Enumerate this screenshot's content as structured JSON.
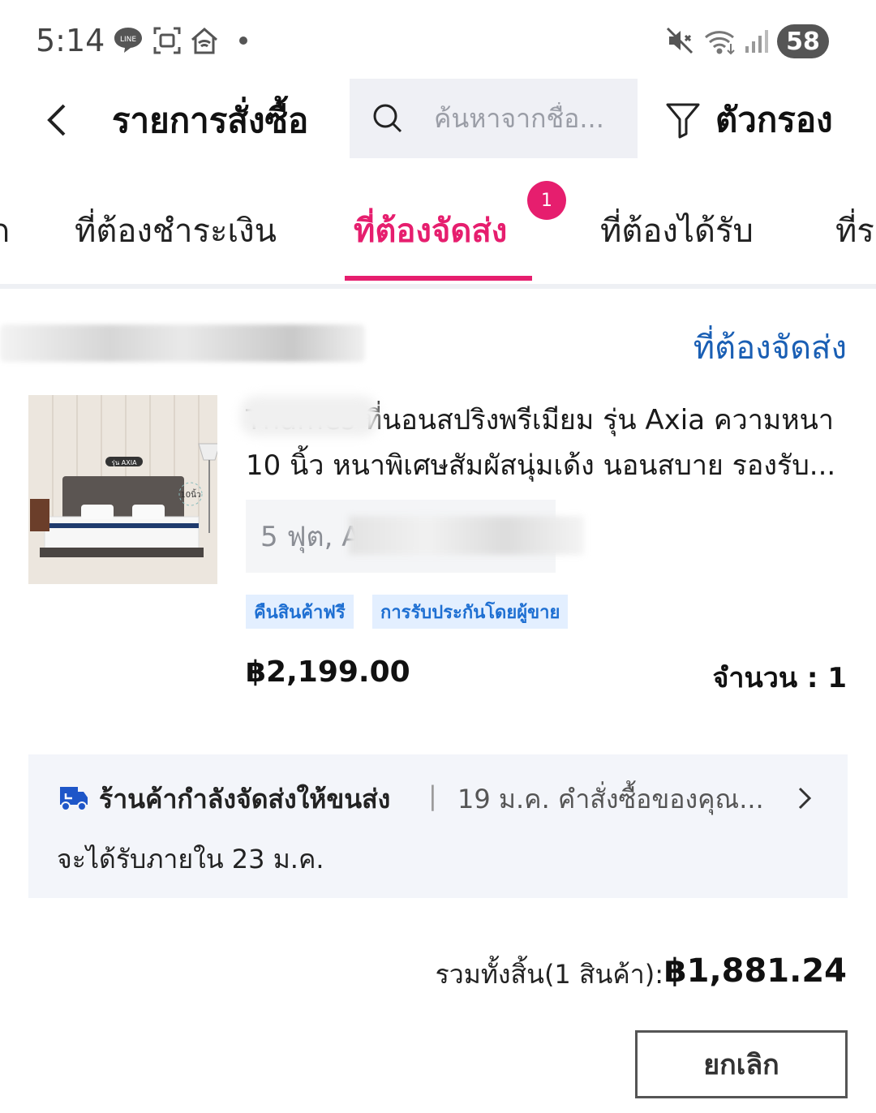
{
  "status_bar": {
    "time": "5:14",
    "battery": "58",
    "line_badge": "LINE"
  },
  "header": {
    "title": "รายการสั่งซื้อ",
    "search_placeholder": "ค้นหาจากชื่อ...",
    "filter_label": "ตัวกรอง"
  },
  "tabs": [
    {
      "label": "ที่ต้องชำระเงิน"
    },
    {
      "label": "ที่ต้องจัดส่ง",
      "active": true,
      "badge": "1"
    },
    {
      "label": "ที่ต้องได้รับ"
    },
    {
      "label": "ที่ร"
    }
  ],
  "order": {
    "status": "ที่ต้องจัดส่ง",
    "product_title": "Thames ที่นอนสปริงพรีเมียม รุ่น Axia ความหนา 10 นิ้ว หนาพิเศษสัมผัสนุ่มเด้ง นอนสบาย รองรับ...",
    "image_text": {
      "model": "รุ่น AXIA",
      "thickness": "10นิ้ว"
    },
    "variant": "5 ฟุต, A",
    "tags": [
      "คืนสินค้าฟรี",
      "การรับประกันโดยผู้ขาย"
    ],
    "price": "฿2,199.00",
    "quantity_label": "จำนวน : 1",
    "shipping": {
      "status": "ร้านค้ากำลังจัดส่งให้ขนส่ง",
      "separator": "|",
      "detail": "19 ม.ค. คำสั่งซื้อของคุณ...",
      "eta": "จะได้รับภายใน 23 ม.ค."
    },
    "total_label": "รวมทั้งสิ้น(1 สินค้า):",
    "total_value": "฿1,881.24",
    "cancel_label": "ยกเลิก"
  },
  "colors": {
    "accent": "#e61e6e",
    "link": "#1a5fb4",
    "tag_bg": "#e3efff",
    "tag_text": "#1e6fd2"
  }
}
